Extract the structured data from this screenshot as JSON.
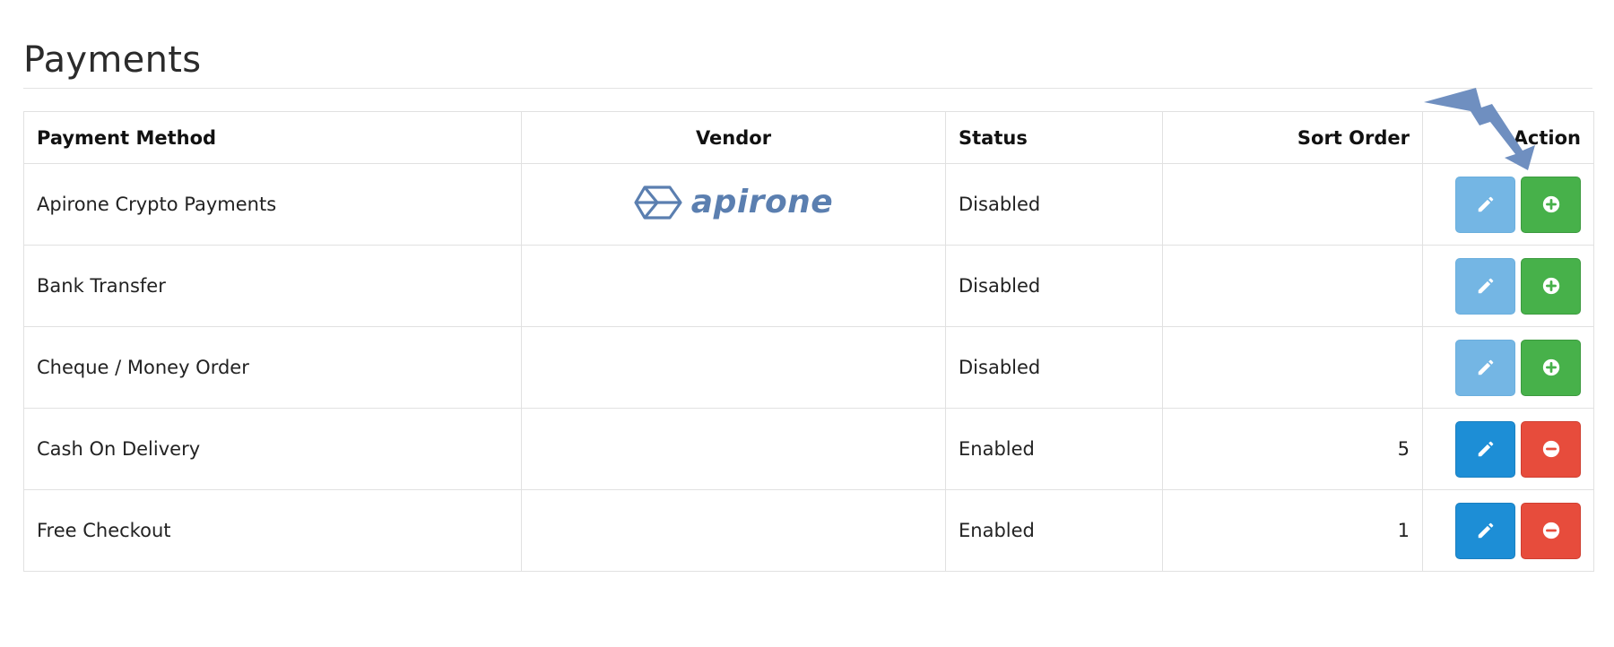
{
  "page": {
    "title": "Payments"
  },
  "table": {
    "headers": {
      "payment_method": "Payment Method",
      "vendor": "Vendor",
      "status": "Status",
      "sort_order": "Sort Order",
      "action": "Action"
    },
    "rows": [
      {
        "method": "Apirone Crypto Payments",
        "vendor_logo": "apirone",
        "status": "Disabled",
        "sort_order": "",
        "installed": false
      },
      {
        "method": "Bank Transfer",
        "vendor_logo": "",
        "status": "Disabled",
        "sort_order": "",
        "installed": false
      },
      {
        "method": "Cheque / Money Order",
        "vendor_logo": "",
        "status": "Disabled",
        "sort_order": "",
        "installed": false
      },
      {
        "method": "Cash On Delivery",
        "vendor_logo": "",
        "status": "Enabled",
        "sort_order": "5",
        "installed": true
      },
      {
        "method": "Free Checkout",
        "vendor_logo": "",
        "status": "Enabled",
        "sort_order": "1",
        "installed": true
      }
    ]
  },
  "icons": {
    "edit": "pencil-icon",
    "install": "plus-circle-icon",
    "uninstall": "minus-circle-icon",
    "annotation": "lightning-arrow-icon"
  },
  "colors": {
    "edit_button": "#1d8ed6",
    "edit_button_disabled": "#74b6e4",
    "install_button": "#47b14a",
    "uninstall_button": "#e74c3c",
    "vendor_logo": "#5b7fb0",
    "annotation_arrow": "#6f8fc0"
  }
}
